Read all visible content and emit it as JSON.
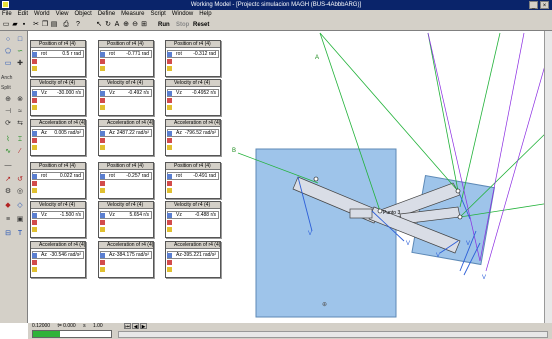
{
  "window": {
    "title": "Working Model - [Projectc simulacion MAGH (BUS-4AbbbARG)]"
  },
  "menu": [
    "File",
    "Edit",
    "World",
    "View",
    "Object",
    "Define",
    "Measure",
    "Script",
    "Window",
    "Help"
  ],
  "toolbar": {
    "run": "Run",
    "stop": "Stop",
    "reset": "Reset"
  },
  "palette_labels": [
    "Anch",
    "Split"
  ],
  "meters": [
    {
      "title": "Position of r4 (4)",
      "key": "rot",
      "value": "0.5 r rad"
    },
    {
      "title": "Position of r4 (4)",
      "key": "rot",
      "value": "-0.771 rad"
    },
    {
      "title": "Position of r4 (4)",
      "key": "rot",
      "value": "-0.312 rad"
    },
    {
      "title": "Velocity of r4 (4)",
      "key": "Vz",
      "value": "-30.000 r/s"
    },
    {
      "title": "Velocity of r4 (4)",
      "key": "Vz",
      "value": "-0.492 r/s"
    },
    {
      "title": "Velocity of r4 (4)",
      "key": "Vz",
      "value": "-0.4952 r/s"
    },
    {
      "title": "Acceleration of r4 (4)",
      "key": "Az",
      "value": "0.005 rad/s²"
    },
    {
      "title": "Acceleration of r4 (4)",
      "key": "Az",
      "value": "2487.22 rad/s²"
    },
    {
      "title": "Acceleration of r4 (4)",
      "key": "Az",
      "value": "-796.52 rad/s²"
    },
    {
      "title": "Position of r4 (4)",
      "key": "rot",
      "value": "0.022 rad"
    },
    {
      "title": "Position of r4 (4)",
      "key": "rot",
      "value": "-0.257 rad"
    },
    {
      "title": "Position of r4 (4)",
      "key": "rot",
      "value": "-0.491 rad"
    },
    {
      "title": "Velocity of r4 (4)",
      "key": "Vz",
      "value": "-1.500 r/s"
    },
    {
      "title": "Velocity of r4 (4)",
      "key": "Vz",
      "value": "5.654 r/s"
    },
    {
      "title": "Velocity of r4 (4)",
      "key": "Vz",
      "value": "-0.488 r/s"
    },
    {
      "title": "Acceleration of r4 (4)",
      "key": "Az",
      "value": "-30.546 rad/s²"
    },
    {
      "title": "Acceleration of r4 (4)",
      "key": "Az",
      "value": "-384.175 rad/s²"
    },
    {
      "title": "Acceleration of r4 (4)",
      "key": "Az",
      "value": "-395.221 rad/s²"
    }
  ],
  "scene": {
    "labels": {
      "a": "A",
      "b": "B",
      "v1": "V",
      "v2": "V",
      "v3": "V",
      "v4": "V",
      "v5": "V",
      "pt": "Punto 3"
    },
    "colors": {
      "body": "#9ec4ea",
      "link": "#d9dde6",
      "force": "#22b23a",
      "vel": "#2d5fd8",
      "acc": "#8a2be2"
    }
  },
  "bottom": {
    "frame": "0.12000",
    "time": "0.000",
    "step": "1.00",
    "progress": 0.35
  }
}
